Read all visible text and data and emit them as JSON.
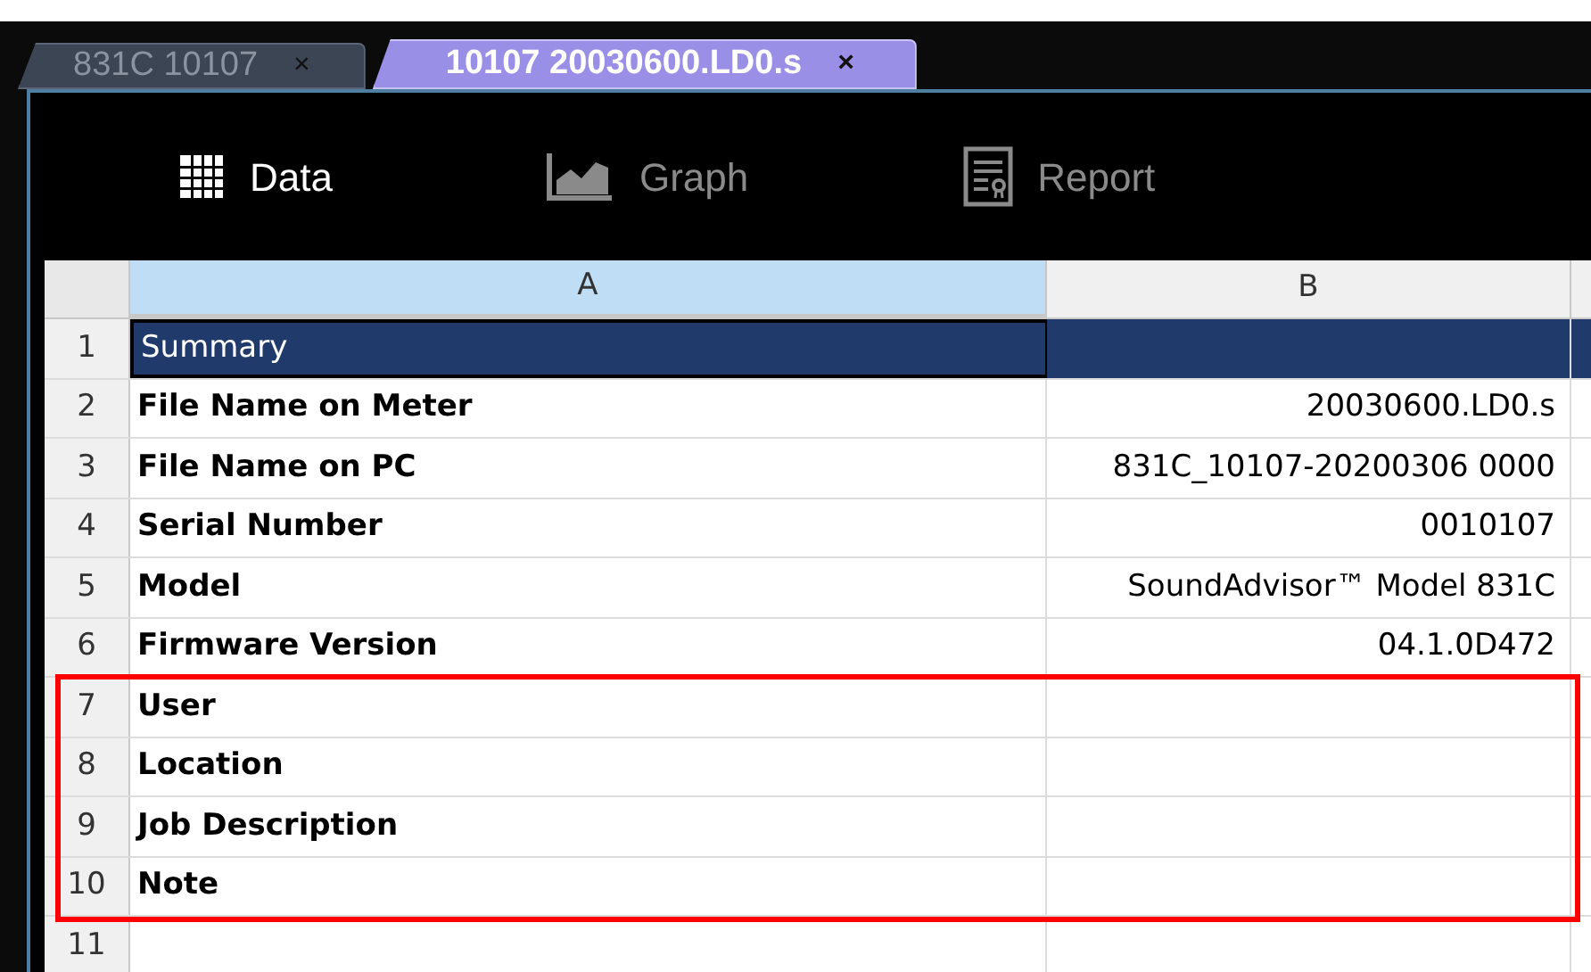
{
  "tabs": [
    {
      "label": "831C 10107",
      "close": "×",
      "selected": false
    },
    {
      "label": "10107 20030600.LD0.s",
      "close": "×",
      "selected": true
    }
  ],
  "toolbar": [
    {
      "label": "Data",
      "kind": "grid",
      "selected": true
    },
    {
      "label": "Graph",
      "kind": "chart",
      "selected": false
    },
    {
      "label": "Report",
      "kind": "report",
      "selected": false
    }
  ],
  "sheet": {
    "columns": [
      {
        "label": "A",
        "selected": true
      },
      {
        "label": "B",
        "selected": false
      }
    ],
    "rows": [
      {
        "number": "1",
        "a": "Summary",
        "b": "",
        "selected": true
      },
      {
        "number": "2",
        "a": "File Name on Meter",
        "b": "20030600.LD0.s",
        "selected": false
      },
      {
        "number": "3",
        "a": "File Name on PC",
        "b": "831C_10107-20200306 0000",
        "selected": false
      },
      {
        "number": "4",
        "a": "Serial Number",
        "b": "0010107",
        "selected": false
      },
      {
        "number": "5",
        "a": "Model",
        "b": "SoundAdvisor™ Model 831C",
        "selected": false
      },
      {
        "number": "6",
        "a": "Firmware Version",
        "b": "04.1.0D472",
        "selected": false
      }
    ],
    "highlighted_rows": [
      {
        "number": "7",
        "a": "User",
        "b": "",
        "selected": false
      },
      {
        "number": "8",
        "a": "Location",
        "b": "",
        "selected": false
      },
      {
        "number": "9",
        "a": "Job Description",
        "b": "",
        "selected": false
      },
      {
        "number": "10",
        "a": "Note",
        "b": "",
        "selected": false
      }
    ],
    "more_rows": [
      {
        "number": "11",
        "a": "",
        "b": "",
        "selected": false
      }
    ]
  }
}
